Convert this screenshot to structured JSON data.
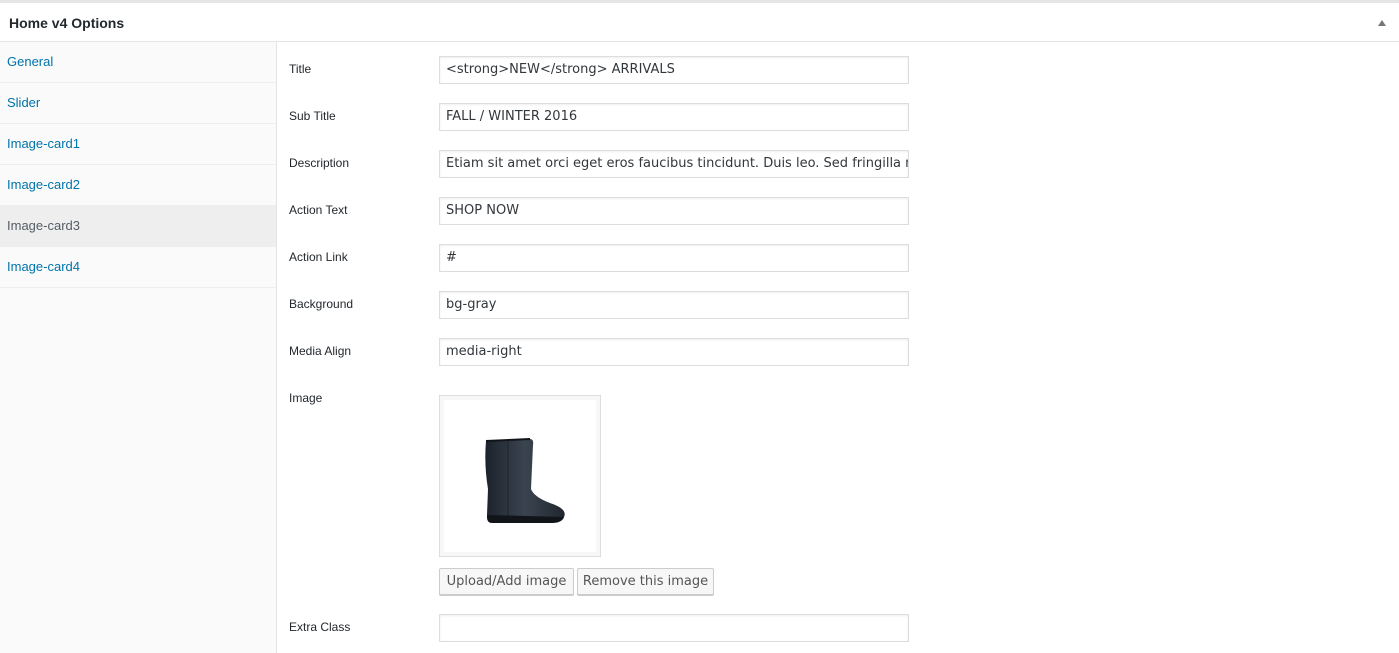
{
  "panel": {
    "title": "Home v4 Options",
    "toggle_icon": "triangle-up-icon"
  },
  "sidebar": {
    "items": [
      {
        "label": "General",
        "active": false
      },
      {
        "label": "Slider",
        "active": false
      },
      {
        "label": "Image-card1",
        "active": false
      },
      {
        "label": "Image-card2",
        "active": false
      },
      {
        "label": "Image-card3",
        "active": true
      },
      {
        "label": "Image-card4",
        "active": false
      }
    ]
  },
  "fields": {
    "title": {
      "label": "Title",
      "value": "<strong>NEW</strong> ARRIVALS"
    },
    "sub_title": {
      "label": "Sub Title",
      "value": "FALL / WINTER 2016"
    },
    "description": {
      "label": "Description",
      "value": "Etiam sit amet orci eget eros faucibus tincidunt. Duis leo. Sed fringilla mauris sit amet nibh."
    },
    "action_text": {
      "label": "Action Text",
      "value": "SHOP NOW"
    },
    "action_link": {
      "label": "Action Link",
      "value": "#"
    },
    "background": {
      "label": "Background",
      "value": "bg-gray"
    },
    "media_align": {
      "label": "Media Align",
      "value": "media-right"
    },
    "image": {
      "label": "Image",
      "image_icon": "boot-image"
    },
    "extra_class": {
      "label": "Extra Class",
      "value": ""
    }
  },
  "buttons": {
    "upload": "Upload/Add image",
    "remove": "Remove this image"
  },
  "colors": {
    "link": "#0073aa",
    "active_nav_text": "#555d66",
    "border": "#dddddd"
  }
}
